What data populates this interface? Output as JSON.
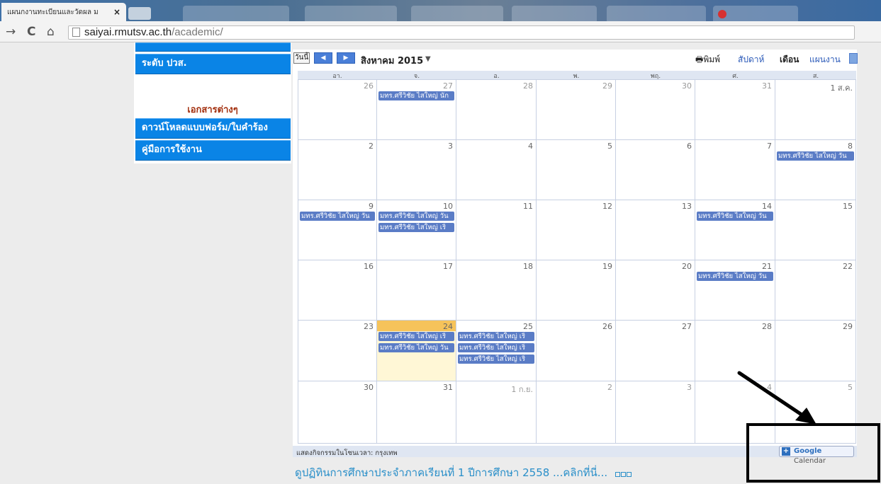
{
  "browser": {
    "tab_title": "แผนกงานทะเบียนและวัดผล ม",
    "tab_close": "×",
    "url_host": "saiyai.rmutsv.ac.th",
    "url_path": "/academic/"
  },
  "sidebar": {
    "button_stub": "",
    "button_level": "ระดับ ปวส.",
    "docs_title": "เอกสารต่างๆ",
    "button_download": "ดาวน์โหลดแบบฟอร์ม/ใบคำร้อง",
    "button_manual": "คู่มือการใช้งาน"
  },
  "calendar": {
    "today_label": "วันนี้",
    "prev_symbol": "◀",
    "next_symbol": "▶",
    "month_title": "สิงหาคม 2015",
    "month_dropdown": "▼",
    "print_label": "🖶พิมพ์",
    "view_week": "สัปดาห์",
    "view_month": "เดือน",
    "view_agenda": "แผนงาน",
    "day_headers": [
      "อา.",
      "จ.",
      "อ.",
      "พ.",
      "พฤ.",
      "ศ.",
      "ส."
    ],
    "weeks": [
      [
        "26",
        "27",
        "28",
        "29",
        "30",
        "31",
        "1 ส.ค."
      ],
      [
        "2",
        "3",
        "4",
        "5",
        "6",
        "7",
        "8"
      ],
      [
        "9",
        "10",
        "11",
        "12",
        "13",
        "14",
        "15"
      ],
      [
        "16",
        "17",
        "18",
        "19",
        "20",
        "21",
        "22"
      ],
      [
        "23",
        "24",
        "25",
        "26",
        "27",
        "28",
        "29"
      ],
      [
        "30",
        "31",
        "1 ก.ย.",
        "2",
        "3",
        "4",
        "5"
      ]
    ],
    "events": [
      {
        "week": 0,
        "day": 1,
        "slot": 0,
        "text": "มทร.ศรีวิชัย ไสใหญ่ นัก"
      },
      {
        "week": 1,
        "day": 6,
        "slot": 0,
        "text": "มทร.ศรีวิชัย ไสใหญ่ วัน"
      },
      {
        "week": 2,
        "day": 0,
        "slot": 0,
        "text": "มทร.ศรีวิชัย ไสใหญ่ วัน"
      },
      {
        "week": 2,
        "day": 1,
        "slot": 0,
        "text": "มทร.ศรีวิชัย ไสใหญ่ วัน"
      },
      {
        "week": 2,
        "day": 1,
        "slot": 1,
        "text": "มทร.ศรีวิชัย ไสใหญ่ เริ่"
      },
      {
        "week": 2,
        "day": 5,
        "slot": 0,
        "text": "มทร.ศรีวิชัย ไสใหญ่ วัน"
      },
      {
        "week": 3,
        "day": 5,
        "slot": 0,
        "text": "มทร.ศรีวิชัย ไสใหญ่ วัน"
      },
      {
        "week": 4,
        "day": 1,
        "slot": 0,
        "text": "มทร.ศรีวิชัย ไสใหญ่ เริ่"
      },
      {
        "week": 4,
        "day": 1,
        "slot": 1,
        "text": "มทร.ศรีวิชัย ไสใหญ่ วัน"
      },
      {
        "week": 4,
        "day": 2,
        "slot": 0,
        "text": "มทร.ศรีวิชัย ไสใหญ่ เริ่"
      },
      {
        "week": 4,
        "day": 2,
        "slot": 1,
        "text": "มทร.ศรีวิชัย ไสใหญ่ เริ่"
      },
      {
        "week": 4,
        "day": 2,
        "slot": 2,
        "text": "มทร.ศรีวิชัย ไสใหญ่ เริ่"
      }
    ],
    "today_week": 4,
    "today_day": 1,
    "other_month": [
      [
        0,
        0
      ],
      [
        0,
        1
      ],
      [
        0,
        2
      ],
      [
        0,
        3
      ],
      [
        0,
        4
      ],
      [
        0,
        5
      ],
      [
        5,
        2
      ],
      [
        5,
        3
      ],
      [
        5,
        4
      ],
      [
        5,
        5
      ],
      [
        5,
        6
      ]
    ],
    "timezone_text": "แสดงกิจกรรมในโซนเวลา: กรุงเทพ",
    "gcal_plus": "+",
    "gcal_google": "Google",
    "gcal_calendar": "Calendar",
    "event_color": "#5a7cc6",
    "today_color": "#f6c35a"
  },
  "bottom_link": "ดูปฏิทินการศึกษาประจำภาคเรียนที่ 1 ปีการศึกษา 2558 ...คลิกที่นี่..."
}
